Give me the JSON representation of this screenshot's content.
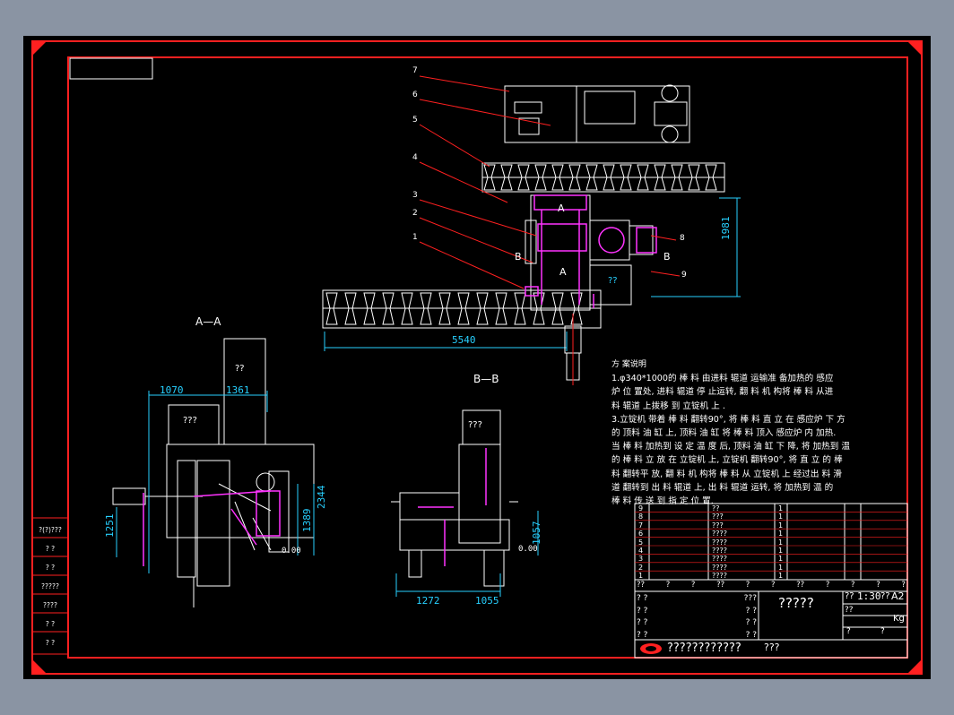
{
  "colors": {
    "background": "#000000",
    "frame": "#ff2020",
    "lines": "#ffffff",
    "dimensions": "#27d0ff",
    "highlight": "#ff33ff",
    "text": "#ffffff",
    "viewport_bg": "#8a94a3"
  },
  "callouts": [
    "7",
    "6",
    "5",
    "4",
    "3",
    "2",
    "1",
    "8",
    "9"
  ],
  "section_markers": {
    "a_top": "A",
    "a_bottom": "A",
    "b_left": "B",
    "b_right": "B"
  },
  "unknown_label": "??",
  "plan_view": {
    "dim_horizontal": "5540",
    "dim_vertical": "1981"
  },
  "section_aa": {
    "title": "A—A",
    "dim_1070": "1070",
    "dim_1361": "1361",
    "dim_2344": "2344",
    "dim_1389": "1389",
    "dim_1251": "1251",
    "label_q2": "??",
    "label_q3": "???",
    "dim_0": "0.00"
  },
  "section_bb": {
    "title": "B—B",
    "label_q3": "???",
    "dim_1272": "1272",
    "dim_1055": "1055",
    "dim_1057": "1057",
    "dim_0": "0.00"
  },
  "description": {
    "heading": "方 案说明",
    "lines": [
      "1.φ340*1000的 棒 料 由进料 辊道 运输准 备加热的 感应",
      "炉 位 置处, 进料 辊道 停 止运转, 翻 料 机 构将 棒 料 从进",
      "料 辊道 上拨移 到 立锭机 上 .",
      "3.立锭机 带着 棒 料 翻转90°, 将 棒 料 直 立 在 感应炉 下 方",
      "的 顶料 油 缸 上, 顶料 油 缸 将 棒 料 顶入 感应炉 内 加热.",
      "当 棒 料 加热到 设 定 温 度 后, 顶料 油 缸 下 降, 将 加热到 温",
      "的 棒 料 立 放 在 立锭机 上, 立锭机 翻转90°, 将 直 立 的 棒",
      "料 翻转平 放, 翻 料 机 构将 棒 料 从 立锭机 上 经过出 料 滑",
      "道 翻转到 出 料 辊道 上, 出 料 辊道 运转, 将 加热到 温 的",
      "棒 料 传 送 到 指 定 位 置."
    ]
  },
  "parts_list": {
    "rows": [
      {
        "no": "9",
        "name": "??",
        "qty": "1"
      },
      {
        "no": "8",
        "name": "???",
        "qty": "1"
      },
      {
        "no": "7",
        "name": "???",
        "qty": "1"
      },
      {
        "no": "6",
        "name": "????",
        "qty": "1"
      },
      {
        "no": "5",
        "name": "????",
        "qty": "1"
      },
      {
        "no": "4",
        "name": "????",
        "qty": "1"
      },
      {
        "no": "3",
        "name": "????",
        "qty": "1"
      },
      {
        "no": "2",
        "name": "????",
        "qty": "1"
      },
      {
        "no": "1",
        "name": "????",
        "qty": "1"
      }
    ],
    "header": [
      "??",
      "?",
      "?",
      "??",
      "?",
      "?",
      "??",
      "?",
      "?",
      "?",
      "?"
    ]
  },
  "title_block": {
    "drawing_name": "?????",
    "scale_label": "??",
    "scale": "1:30",
    "sheet_size_label": "??",
    "sheet_size": "A2",
    "weight_unit": "Kg",
    "drawing_title": "????????????",
    "drawing_title_tail": "???",
    "cells": [
      "? ?",
      "???",
      "? ?",
      "? ?",
      "? ?",
      "? ?",
      "? ?",
      "? ?",
      "? ?",
      "? ?"
    ],
    "small_q": "?",
    "double_q": "??"
  },
  "side_stamp": {
    "labels": [
      "?(?)???",
      "? ?",
      "? ?",
      "?????",
      "????",
      "? ?",
      "? ?"
    ]
  },
  "top_left_box": ""
}
